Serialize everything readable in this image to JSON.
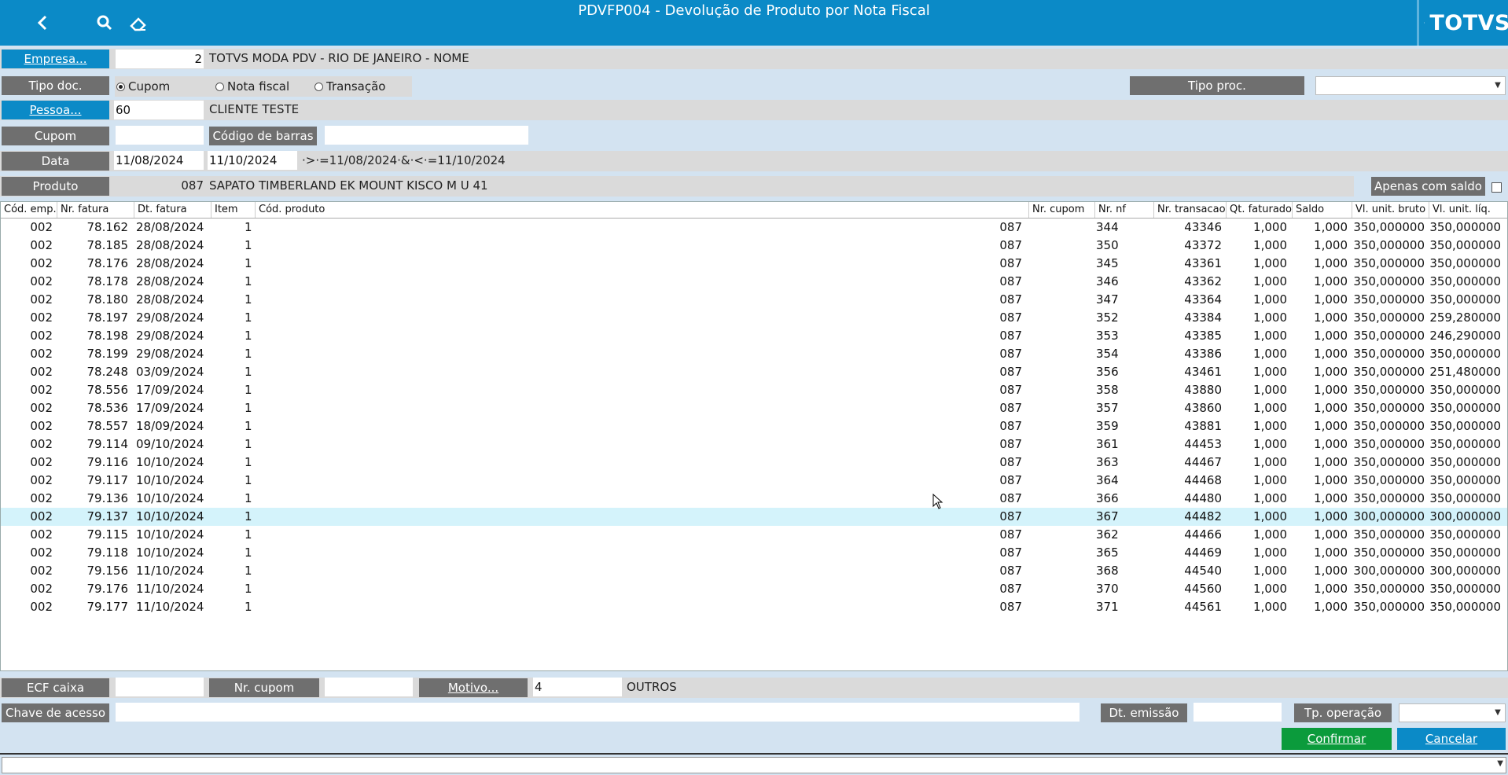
{
  "header": {
    "title": "PDVFP004 - Devolução de Produto por Nota Fiscal",
    "logo": "TOTVS"
  },
  "form": {
    "empresa_label": "Empresa...",
    "empresa_code": "2",
    "empresa_name": "TOTVS MODA PDV - RIO DE JANEIRO - NOME",
    "tipo_doc_label": "Tipo doc.",
    "tipo_doc_options": [
      "Cupom",
      "Nota fiscal",
      "Transação"
    ],
    "tipo_doc_selected": "Cupom",
    "tipo_proc_label": "Tipo proc.",
    "tipo_proc_value": "",
    "pessoa_label": "Pessoa...",
    "pessoa_code": "60",
    "pessoa_name": "CLIENTE TESTE",
    "cupom_label": "Cupom",
    "cupom_value": "",
    "barcode_label": "Código de barras",
    "barcode_value": "",
    "data_label": "Data",
    "data_from": "11/08/2024",
    "data_to": "11/10/2024",
    "data_expr": "·>·=11/08/2024·&·<·=11/10/2024",
    "produto_label": "Produto",
    "produto_code": "087",
    "produto_name": "SAPATO TIMBERLAND EK MOUNT KISCO M U 41",
    "apenas_saldo_label": "Apenas com saldo",
    "apenas_saldo_checked": false
  },
  "table": {
    "columns": [
      "Cód. emp.",
      "Nr. fatura",
      "Dt. fatura",
      "Item",
      "Cód. produto",
      "Nr. cupom",
      "Nr. nf",
      "Nr. transacao",
      "Qt. faturado",
      "Saldo",
      "Vl. unit. bruto",
      "Vl. unit. líq."
    ],
    "selected_index": 16,
    "rows": [
      [
        "002",
        "78.162",
        "28/08/2024",
        "1",
        "087",
        "",
        "344",
        "43346",
        "1,000",
        "1,000",
        "350,000000",
        "350,000000"
      ],
      [
        "002",
        "78.185",
        "28/08/2024",
        "1",
        "087",
        "",
        "350",
        "43372",
        "1,000",
        "1,000",
        "350,000000",
        "350,000000"
      ],
      [
        "002",
        "78.176",
        "28/08/2024",
        "1",
        "087",
        "",
        "345",
        "43361",
        "1,000",
        "1,000",
        "350,000000",
        "350,000000"
      ],
      [
        "002",
        "78.178",
        "28/08/2024",
        "1",
        "087",
        "",
        "346",
        "43362",
        "1,000",
        "1,000",
        "350,000000",
        "350,000000"
      ],
      [
        "002",
        "78.180",
        "28/08/2024",
        "1",
        "087",
        "",
        "347",
        "43364",
        "1,000",
        "1,000",
        "350,000000",
        "350,000000"
      ],
      [
        "002",
        "78.197",
        "29/08/2024",
        "1",
        "087",
        "",
        "352",
        "43384",
        "1,000",
        "1,000",
        "350,000000",
        "259,280000"
      ],
      [
        "002",
        "78.198",
        "29/08/2024",
        "1",
        "087",
        "",
        "353",
        "43385",
        "1,000",
        "1,000",
        "350,000000",
        "246,290000"
      ],
      [
        "002",
        "78.199",
        "29/08/2024",
        "1",
        "087",
        "",
        "354",
        "43386",
        "1,000",
        "1,000",
        "350,000000",
        "350,000000"
      ],
      [
        "002",
        "78.248",
        "03/09/2024",
        "1",
        "087",
        "",
        "356",
        "43461",
        "1,000",
        "1,000",
        "350,000000",
        "251,480000"
      ],
      [
        "002",
        "78.556",
        "17/09/2024",
        "1",
        "087",
        "",
        "358",
        "43880",
        "1,000",
        "1,000",
        "350,000000",
        "350,000000"
      ],
      [
        "002",
        "78.536",
        "17/09/2024",
        "1",
        "087",
        "",
        "357",
        "43860",
        "1,000",
        "1,000",
        "350,000000",
        "350,000000"
      ],
      [
        "002",
        "78.557",
        "18/09/2024",
        "1",
        "087",
        "",
        "359",
        "43881",
        "1,000",
        "1,000",
        "350,000000",
        "350,000000"
      ],
      [
        "002",
        "79.114",
        "09/10/2024",
        "1",
        "087",
        "",
        "361",
        "44453",
        "1,000",
        "1,000",
        "350,000000",
        "350,000000"
      ],
      [
        "002",
        "79.116",
        "10/10/2024",
        "1",
        "087",
        "",
        "363",
        "44467",
        "1,000",
        "1,000",
        "350,000000",
        "350,000000"
      ],
      [
        "002",
        "79.117",
        "10/10/2024",
        "1",
        "087",
        "",
        "364",
        "44468",
        "1,000",
        "1,000",
        "350,000000",
        "350,000000"
      ],
      [
        "002",
        "79.136",
        "10/10/2024",
        "1",
        "087",
        "",
        "366",
        "44480",
        "1,000",
        "1,000",
        "350,000000",
        "350,000000"
      ],
      [
        "002",
        "79.137",
        "10/10/2024",
        "1",
        "087",
        "",
        "367",
        "44482",
        "1,000",
        "1,000",
        "300,000000",
        "300,000000"
      ],
      [
        "002",
        "79.115",
        "10/10/2024",
        "1",
        "087",
        "",
        "362",
        "44466",
        "1,000",
        "1,000",
        "350,000000",
        "350,000000"
      ],
      [
        "002",
        "79.118",
        "10/10/2024",
        "1",
        "087",
        "",
        "365",
        "44469",
        "1,000",
        "1,000",
        "350,000000",
        "350,000000"
      ],
      [
        "002",
        "79.156",
        "11/10/2024",
        "1",
        "087",
        "",
        "368",
        "44540",
        "1,000",
        "1,000",
        "300,000000",
        "300,000000"
      ],
      [
        "002",
        "79.176",
        "11/10/2024",
        "1",
        "087",
        "",
        "370",
        "44560",
        "1,000",
        "1,000",
        "350,000000",
        "350,000000"
      ],
      [
        "002",
        "79.177",
        "11/10/2024",
        "1",
        "087",
        "",
        "371",
        "44561",
        "1,000",
        "1,000",
        "350,000000",
        "350,000000"
      ]
    ]
  },
  "footer": {
    "ecf_label": "ECF caixa",
    "ecf_value": "",
    "nr_cupom_label": "Nr. cupom",
    "nr_cupom_value": "",
    "motivo_label": "Motivo...",
    "motivo_code": "4",
    "motivo_name": "OUTROS",
    "chave_label": "Chave de acesso",
    "chave_value": "",
    "dt_emissao_label": "Dt. emissão",
    "dt_emissao_value": "",
    "tp_operacao_label": "Tp. operação",
    "tp_operacao_value": "",
    "confirm_label": "Confirmar",
    "cancel_label": "Cancelar"
  },
  "colors": {
    "accent": "#0b8ac7",
    "confirm": "#0b9b3c",
    "label_gray": "#6f6f6f",
    "background": "#d3e3f1",
    "selected_row": "#d4f3fb"
  }
}
